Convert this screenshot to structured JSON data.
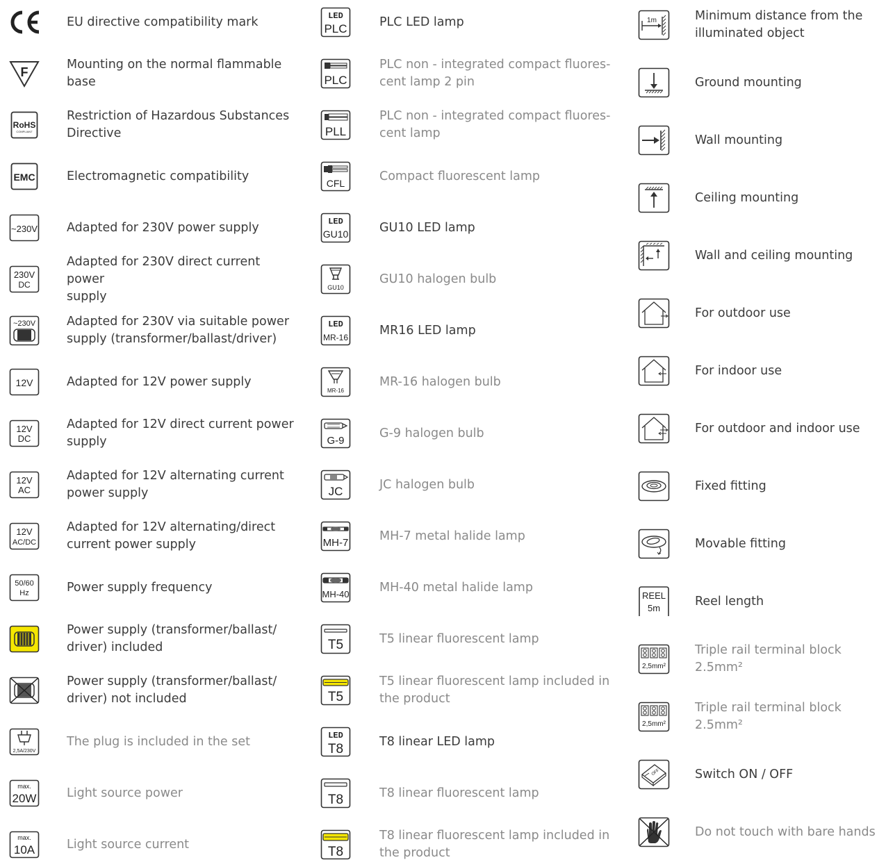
{
  "columns": [
    {
      "items": [
        {
          "icon": "ce-mark-icon",
          "text": "EU directive compatibility mark",
          "dim": false
        },
        {
          "icon": "flammable-base-icon",
          "text": "Mounting on the normal flammable\nbase",
          "dim": false
        },
        {
          "icon": "rohs-icon",
          "text": "Restriction of Hazardous Substances\nDirective",
          "dim": false
        },
        {
          "icon": "emc-icon",
          "text": "Electromagnetic compatibility",
          "dim": false
        },
        {
          "icon": "230v-icon",
          "text": "Adapted for 230V power supply",
          "dim": false
        },
        {
          "icon": "230v-dc-icon",
          "text": "Adapted for 230V direct current power\nsupply",
          "dim": false
        },
        {
          "icon": "230v-driver-icon",
          "text": "Adapted for 230V via suitable power\nsupply (transformer/ballast/driver)",
          "dim": false
        },
        {
          "icon": "12v-icon",
          "text": "Adapted for 12V power supply",
          "dim": false
        },
        {
          "icon": "12v-dc-icon",
          "text": "Adapted for 12V direct current power\nsupply",
          "dim": false
        },
        {
          "icon": "12v-ac-icon",
          "text": "Adapted for 12V alternating current\npower supply",
          "dim": false
        },
        {
          "icon": "12v-acdc-icon",
          "text": "Adapted for 12V alternating/direct\ncurrent power supply",
          "dim": false
        },
        {
          "icon": "frequency-icon",
          "text": "Power supply frequency",
          "dim": false
        },
        {
          "icon": "driver-included-icon",
          "text": "Power supply (transformer/ballast/\ndriver) included",
          "dim": false
        },
        {
          "icon": "driver-not-included-icon",
          "text": "Power supply (transformer/ballast/\ndriver) not included",
          "dim": false
        },
        {
          "icon": "plug-icon",
          "text": "The plug is included in the set",
          "dim": true
        },
        {
          "icon": "max-20w-icon",
          "text": "Light source power",
          "dim": true
        },
        {
          "icon": "max-10a-icon",
          "text": "Light source current",
          "dim": true
        }
      ]
    },
    {
      "items": [
        {
          "icon": "led-plc-icon",
          "text": "PLC LED lamp",
          "dim": false
        },
        {
          "icon": "plc-2pin-icon",
          "text": "PLC non - integrated compact fluores-\ncent lamp 2 pin",
          "dim": true
        },
        {
          "icon": "pll-icon",
          "text": "PLC non - integrated compact fluores-\ncent lamp",
          "dim": true
        },
        {
          "icon": "cfl-icon",
          "text": "Compact fluorescent lamp",
          "dim": true
        },
        {
          "icon": "led-gu10-icon",
          "text": "GU10 LED lamp",
          "dim": false
        },
        {
          "icon": "gu10-halogen-icon",
          "text": "GU10 halogen bulb",
          "dim": true
        },
        {
          "icon": "led-mr16-icon",
          "text": "MR16 LED lamp",
          "dim": false
        },
        {
          "icon": "mr16-halogen-icon",
          "text": "MR-16 halogen bulb",
          "dim": true
        },
        {
          "icon": "g9-icon",
          "text": "G-9 halogen bulb",
          "dim": true
        },
        {
          "icon": "jc-icon",
          "text": " JC halogen bulb",
          "dim": true
        },
        {
          "icon": "mh7-icon",
          "text": "MH-7 metal halide lamp",
          "dim": true
        },
        {
          "icon": "mh40-icon",
          "text": "MH-40 metal halide lamp",
          "dim": true
        },
        {
          "icon": "t5-icon",
          "text": "T5 linear fluorescent lamp",
          "dim": true
        },
        {
          "icon": "t5-included-icon",
          "text": "T5 linear fluorescent lamp included in\nthe product",
          "dim": true
        },
        {
          "icon": "led-t8-icon",
          "text": "T8 linear LED lamp",
          "dim": false
        },
        {
          "icon": "t8-icon",
          "text": "T8 linear fluorescent lamp",
          "dim": true
        },
        {
          "icon": "t8-included-icon",
          "text": "T8 linear fluorescent lamp included in\nthe product",
          "dim": true
        }
      ]
    },
    {
      "items": [
        {
          "icon": "min-distance-icon",
          "text": "Minimum distance from the\nilluminated object",
          "dim": false
        },
        {
          "icon": "ground-mounting-icon",
          "text": "Ground mounting",
          "dim": false
        },
        {
          "icon": "wall-mounting-icon",
          "text": "Wall mounting",
          "dim": false
        },
        {
          "icon": "ceiling-mounting-icon",
          "text": "Ceiling mounting",
          "dim": false
        },
        {
          "icon": "wall-ceiling-mounting-icon",
          "text": "Wall and ceiling mounting",
          "dim": false
        },
        {
          "icon": "outdoor-icon",
          "text": "For outdoor use",
          "dim": false
        },
        {
          "icon": "indoor-icon",
          "text": "For indoor use",
          "dim": false
        },
        {
          "icon": "outdoor-indoor-icon",
          "text": "For outdoor and indoor use",
          "dim": false
        },
        {
          "icon": "fixed-fitting-icon",
          "text": "Fixed fitting",
          "dim": false
        },
        {
          "icon": "movable-fitting-icon",
          "text": "Movable fitting",
          "dim": false
        },
        {
          "icon": "reel-icon",
          "text": "Reel length",
          "dim": false
        },
        {
          "icon": "terminal-block-icon",
          "text": "Triple rail terminal block 2.5mm²",
          "dim": true
        },
        {
          "icon": "terminal-block-icon",
          "text": "Triple rail terminal block 2.5mm²",
          "dim": true
        },
        {
          "icon": "switch-icon",
          "text": "Switch ON / OFF",
          "dim": false
        },
        {
          "icon": "no-bare-hands-icon",
          "text": "Do not touch with bare hands",
          "dim": true
        }
      ]
    }
  ],
  "icon_text": {
    "flammable": "F",
    "rohs_main": "RoHS",
    "rohs_sub": "COMPLIANT",
    "emc": "EMC",
    "v230": "~230V",
    "v230dc_1": "230V",
    "v230dc_2": "DC",
    "v230drv": "~230V",
    "v12": "12V",
    "v12dc_1": "12V",
    "v12dc_2": "DC",
    "v12ac_1": "12V",
    "v12ac_2": "AC",
    "v12acdc_1": "12V",
    "v12acdc_2": "AC/DC",
    "freq_1": "50/60",
    "freq_2": "Hz",
    "plug": "2,5A/230V",
    "max": "max.",
    "w20": "20W",
    "a10": "10A",
    "led": "LED",
    "plc": "PLC",
    "pll": "PLL",
    "cfl": "CFL",
    "gu10": "GU10",
    "mr16": "MR-16",
    "g9": "G-9",
    "jc": "JC",
    "mh7": "MH-7",
    "mh40": "MH-40",
    "t5": "T5",
    "t8": "T8",
    "dist": "1m",
    "reel_1": "REEL",
    "reel_2": "5m",
    "mm": "2,5mm²",
    "off": "OFF"
  },
  "colors": {
    "text": "#3c3c3c",
    "text_dim": "#8a8a8a",
    "icon_stroke": "#333333",
    "highlight_yellow": "#f5e600"
  }
}
